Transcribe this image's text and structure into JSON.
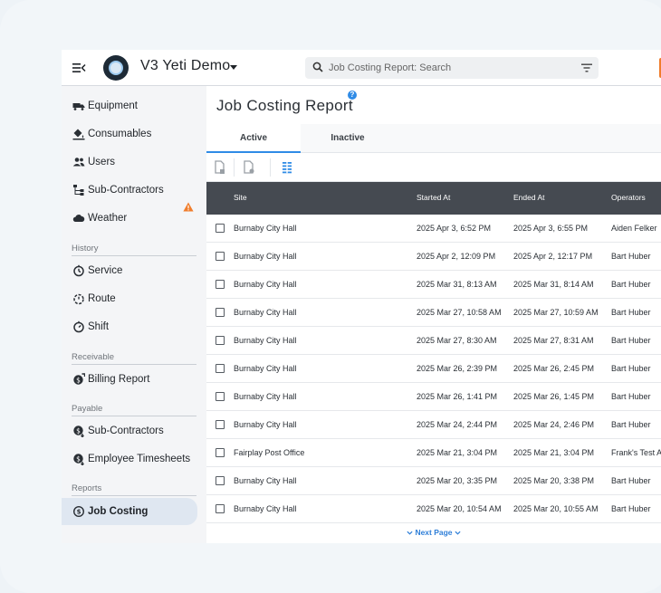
{
  "header": {
    "app_title": "V3 Yeti Demo",
    "search_placeholder": "Job Costing Report: Search"
  },
  "sidebar": {
    "items_top": [
      {
        "label": "Equipment",
        "icon": "truck-icon"
      },
      {
        "label": "Consumables",
        "icon": "paint-bucket-icon"
      },
      {
        "label": "Users",
        "icon": "users-icon"
      },
      {
        "label": "Sub-Contractors",
        "icon": "hierarchy-icon"
      },
      {
        "label": "Weather",
        "icon": "cloud-icon"
      }
    ],
    "sections": {
      "history": {
        "title": "History",
        "items": [
          "Service",
          "Route",
          "Shift"
        ]
      },
      "receivable": {
        "title": "Receivable",
        "items": [
          "Billing Report"
        ]
      },
      "payable": {
        "title": "Payable",
        "items": [
          "Sub-Contractors",
          "Employee Timesheets"
        ]
      },
      "reports": {
        "title": "Reports",
        "items": [
          "Job Costing"
        ]
      }
    },
    "active_item": "Job Costing"
  },
  "main": {
    "title": "Job Costing Report",
    "tabs": [
      "Active",
      "Inactive"
    ],
    "active_tab": "Active",
    "columns": [
      "Site",
      "Started At",
      "Ended At",
      "Operators"
    ],
    "rows": [
      {
        "site": "Burnaby City Hall",
        "started": "2025 Apr 3, 6:52 PM",
        "ended": "2025 Apr 3, 6:55 PM",
        "operators": "Aiden Felker"
      },
      {
        "site": "Burnaby City Hall",
        "started": "2025 Apr 2, 12:09 PM",
        "ended": "2025 Apr 2, 12:17 PM",
        "operators": "Bart Huber"
      },
      {
        "site": "Burnaby City Hall",
        "started": "2025 Mar 31, 8:13 AM",
        "ended": "2025 Mar 31, 8:14 AM",
        "operators": "Bart Huber"
      },
      {
        "site": "Burnaby City Hall",
        "started": "2025 Mar 27, 10:58 AM",
        "ended": "2025 Mar 27, 10:59 AM",
        "operators": "Bart Huber"
      },
      {
        "site": "Burnaby City Hall",
        "started": "2025 Mar 27, 8:30 AM",
        "ended": "2025 Mar 27, 8:31 AM",
        "operators": "Bart Huber"
      },
      {
        "site": "Burnaby City Hall",
        "started": "2025 Mar 26, 2:39 PM",
        "ended": "2025 Mar 26, 2:45 PM",
        "operators": "Bart Huber"
      },
      {
        "site": "Burnaby City Hall",
        "started": "2025 Mar 26, 1:41 PM",
        "ended": "2025 Mar 26, 1:45 PM",
        "operators": "Bart Huber"
      },
      {
        "site": "Burnaby City Hall",
        "started": "2025 Mar 24, 2:44 PM",
        "ended": "2025 Mar 24, 2:46 PM",
        "operators": "Bart Huber"
      },
      {
        "site": "Fairplay Post Office",
        "started": "2025 Mar 21, 3:04 PM",
        "ended": "2025 Mar 21, 3:04 PM",
        "operators": "Frank's Test A"
      },
      {
        "site": "Burnaby City Hall",
        "started": "2025 Mar 20, 3:35 PM",
        "ended": "2025 Mar 20, 3:38 PM",
        "operators": "Bart Huber"
      },
      {
        "site": "Burnaby City Hall",
        "started": "2025 Mar 20, 10:54 AM",
        "ended": "2025 Mar 20, 10:55 AM",
        "operators": "Bart Huber"
      }
    ],
    "next_page_label": "Next Page"
  },
  "colors": {
    "accent": "#2f8be6",
    "header_row": "#454a51",
    "warning": "#f07d2c"
  }
}
